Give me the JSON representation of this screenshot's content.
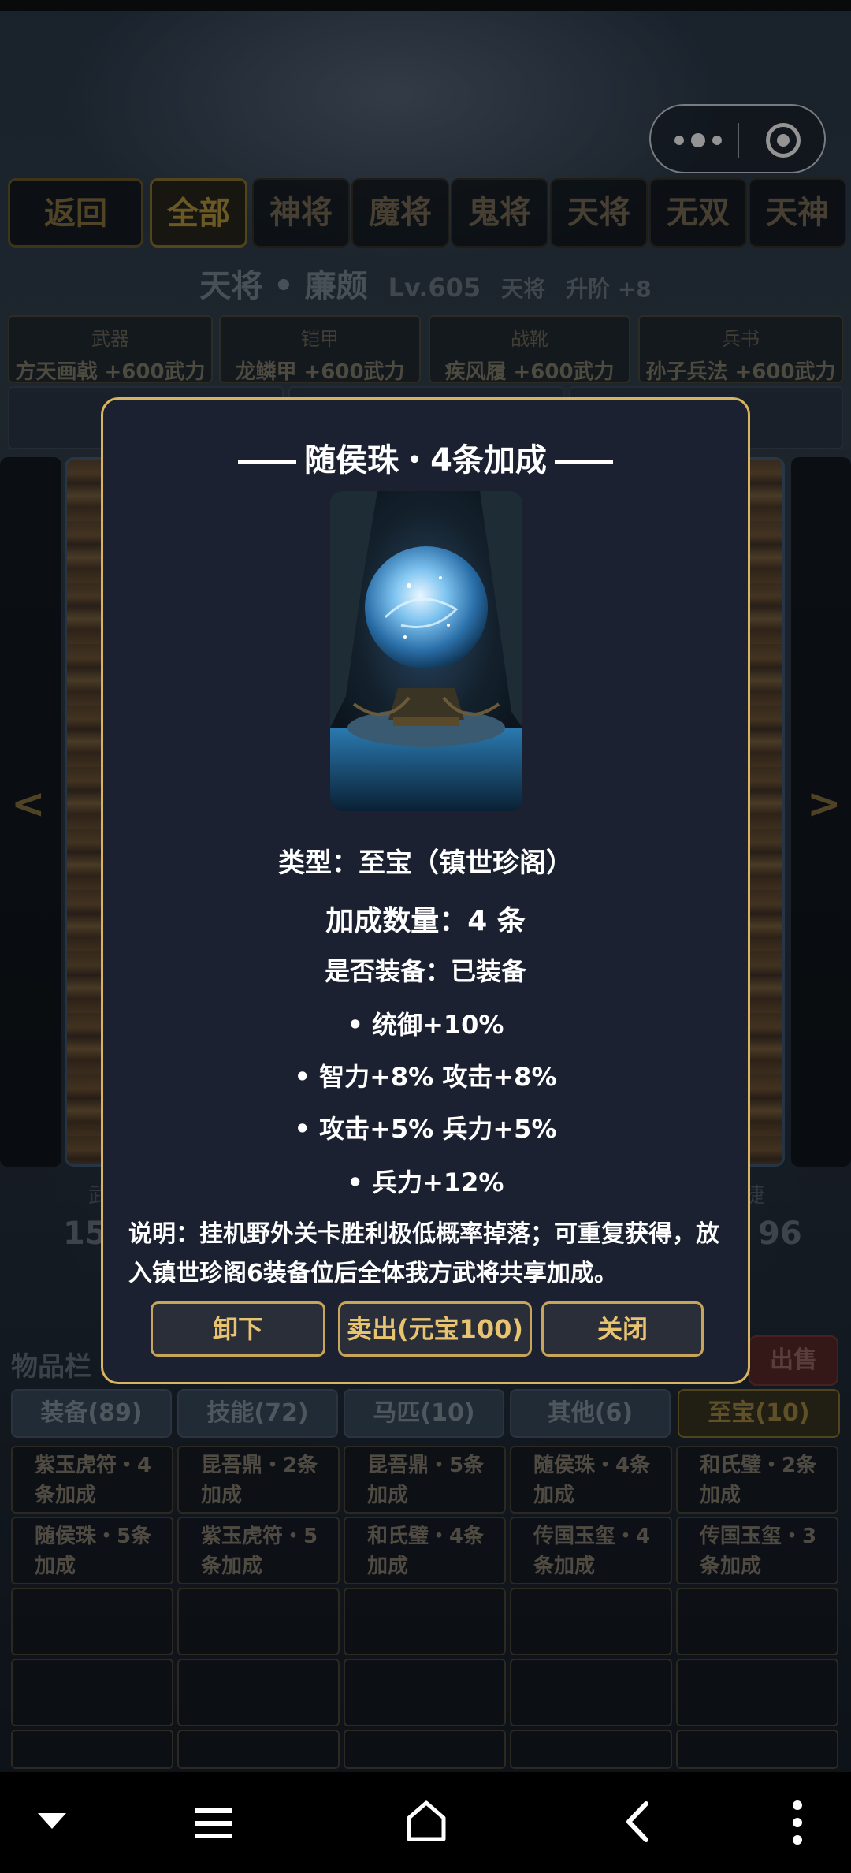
{
  "app": {
    "tabs": [
      "返回",
      "全部",
      "神将",
      "魔将",
      "鬼将",
      "天将",
      "无双",
      "天神"
    ],
    "active_tab": "全部"
  },
  "hero": {
    "name": "天将 • 廉颇",
    "level": "Lv.605",
    "rank": "天将",
    "promote": "升阶 +8"
  },
  "equipment": [
    {
      "slot": "武器",
      "value": "方天画戟 +600武力"
    },
    {
      "slot": "铠甲",
      "value": "龙鳞甲 +600武力"
    },
    {
      "slot": "战靴",
      "value": "疾风履 +600武力"
    },
    {
      "slot": "兵书",
      "value": "孙子兵法 +600武力"
    }
  ],
  "nav_arrows": {
    "left": "<",
    "right": ">"
  },
  "stats_partial": {
    "left_label": "武",
    "left_value": "15",
    "right_label": "捷",
    "right_value": "96"
  },
  "inventory": {
    "title": "物品栏",
    "sell_label": "出售",
    "categories": [
      "装备(89)",
      "技能(72)",
      "马匹(10)",
      "其他(6)",
      "至宝(10)"
    ],
    "active_category": "至宝(10)",
    "items": [
      "紫玉虎符・4条加成",
      "昆吾鼎・2条加成",
      "昆吾鼎・5条加成",
      "随侯珠・4条加成",
      "和氏璧・2条加成",
      "随侯珠・5条加成",
      "紫玉虎符・5条加成",
      "和氏璧・4条加成",
      "传国玉玺・4条加成",
      "传国玉玺・3条加成"
    ]
  },
  "modal": {
    "title": "随侯珠・4条加成",
    "type_line": "类型：至宝（镇世珍阁）",
    "count_line": "加成数量：4 条",
    "equipped_line": "是否装备：已装备",
    "bonuses": [
      "• 统御+10%",
      "• 智力+8% 攻击+8%",
      "• 攻击+5% 兵力+5%",
      "• 兵力+12%"
    ],
    "description": "说明：挂机野外关卡胜利极低概率掉落；可重复获得，放入镇世珍阁6装备位后全体我方武将共享加成。",
    "buttons": {
      "unequip": "卸下",
      "sell": "卖出(元宝100)",
      "close": "关闭"
    }
  },
  "icons": {
    "capsule_menu": "more-dots-icon",
    "capsule_close": "target-close-icon",
    "nav": [
      "chevron-down-icon",
      "menu-lines-icon",
      "home-icon",
      "back-icon",
      "more-vertical-icon"
    ]
  }
}
